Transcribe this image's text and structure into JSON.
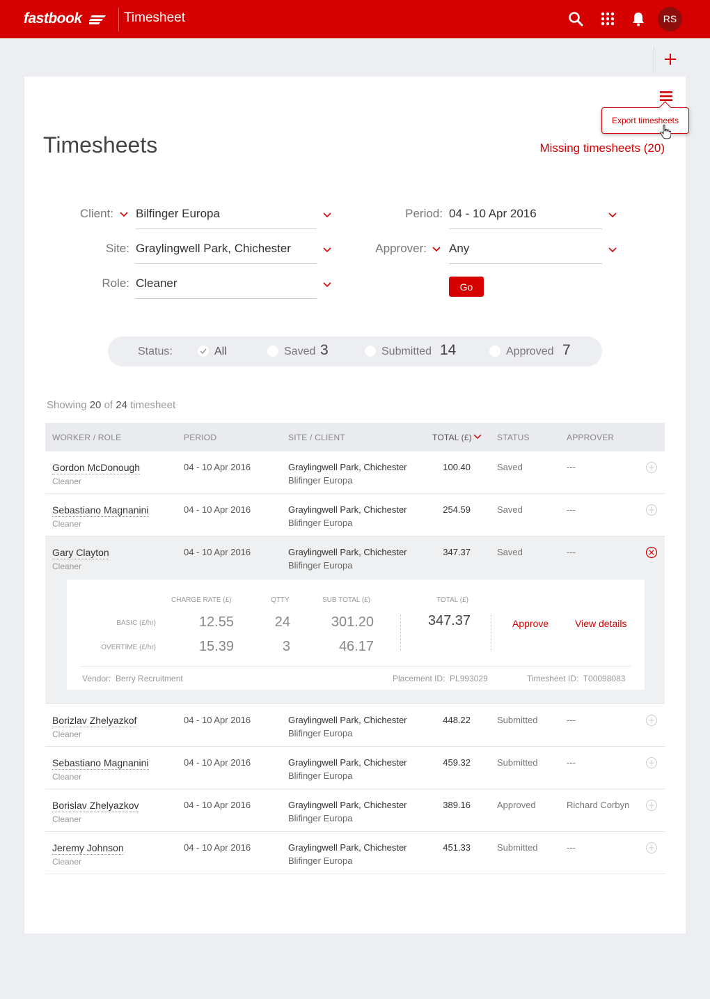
{
  "app": {
    "brand": "fastbook",
    "title": "Timesheet",
    "avatar_initials": "RS",
    "accent": "#d50000"
  },
  "header_actions": {
    "export_tooltip": "Export timesheets"
  },
  "page": {
    "title": "Timesheets",
    "missing_link": "Missing timesheets (20)"
  },
  "filters": {
    "client_label": "Client:",
    "client_value": "Bilfinger Europa",
    "site_label": "Site:",
    "site_value": "Graylingwell Park, Chichester",
    "role_label": "Role:",
    "role_value": "Cleaner",
    "period_label": "Period:",
    "period_value": "04 - 10 Apr 2016",
    "approver_label": "Approver:",
    "approver_value": "Any",
    "go_label": "Go"
  },
  "status": {
    "label": "Status:",
    "options": [
      {
        "label": "All",
        "count": "",
        "selected": true
      },
      {
        "label": "Saved",
        "count": "3",
        "selected": false
      },
      {
        "label": "Submitted",
        "count": "14",
        "selected": false
      },
      {
        "label": "Approved",
        "count": "7",
        "selected": false
      }
    ]
  },
  "showing": {
    "prefix": "Showing",
    "shown": "20",
    "of": "of",
    "total": "24",
    "suffix": "timesheet"
  },
  "table": {
    "headers": {
      "worker": "WORKER / ROLE",
      "period": "PERIOD",
      "site": "SITE / CLIENT",
      "total": "TOTAL (£)",
      "status": "STATUS",
      "approver": "APPROVER"
    },
    "rows": [
      {
        "worker": "Gordon McDonough",
        "role": "Cleaner",
        "period": "04 - 10 Apr 2016",
        "site": "Graylingwell Park, Chichester",
        "client": "Blifinger Europa",
        "total": "100.40",
        "status": "Saved",
        "approver": "---"
      },
      {
        "worker": "Sebastiano Magnanini",
        "role": "Cleaner",
        "period": "04 - 10 Apr 2016",
        "site": "Graylingwell Park, Chichester",
        "client": "Blifinger Europa",
        "total": "254.59",
        "status": "Saved",
        "approver": "---"
      },
      {
        "worker": "Gary Clayton",
        "role": "Cleaner",
        "period": "04 - 10 Apr 2016",
        "site": "Graylingwell Park, Chichester",
        "client": "Blifinger Europa",
        "total": "347.37",
        "status": "Saved",
        "approver": "---"
      },
      {
        "worker": "Borizlav Zhelyazkof",
        "role": "Cleaner",
        "period": "04 - 10 Apr 2016",
        "site": "Graylingwell Park, Chichester",
        "client": "Blifinger Europa",
        "total": "448.22",
        "status": "Submitted",
        "approver": "---"
      },
      {
        "worker": "Sebastiano Magnanini",
        "role": "Cleaner",
        "period": "04 - 10 Apr 2016",
        "site": "Graylingwell Park, Chichester",
        "client": "Blifinger Europa",
        "total": "459.32",
        "status": "Submitted",
        "approver": "---"
      },
      {
        "worker": "Borislav Zhelyazkov",
        "role": "Cleaner",
        "period": "04 - 10 Apr 2016",
        "site": "Graylingwell Park, Chichester",
        "client": "Blifinger Europa",
        "total": "389.16",
        "status": "Approved",
        "approver": "Richard Corbyn"
      },
      {
        "worker": "Jeremy Johnson",
        "role": "Cleaner",
        "period": "04 - 10 Apr 2016",
        "site": "Graylingwell Park, Chichester",
        "client": "Blifinger Europa",
        "total": "451.33",
        "status": "Submitted",
        "approver": "---"
      }
    ]
  },
  "detail": {
    "headers": {
      "charge_rate": "CHARGE RATE (£)",
      "qty": "QTTY",
      "subtotal": "SUB TOTAL (£)",
      "total": "TOTAL (£)"
    },
    "basic": {
      "label": "BASIC (£/hr)",
      "rate": "12.55",
      "qty": "24",
      "subtotal": "301.20"
    },
    "overtime": {
      "label": "OVERTIME (£/hr)",
      "rate": "15.39",
      "qty": "3",
      "subtotal": "46.17"
    },
    "total": "347.37",
    "approve_label": "Approve",
    "view_label": "View details",
    "vendor_label": "Vendor:",
    "vendor_value": "Berry Recruitment",
    "placement_label": "Placement ID:",
    "placement_value": "PL993029",
    "timesheet_label": "Timesheet ID:",
    "timesheet_value": "T00098083"
  }
}
